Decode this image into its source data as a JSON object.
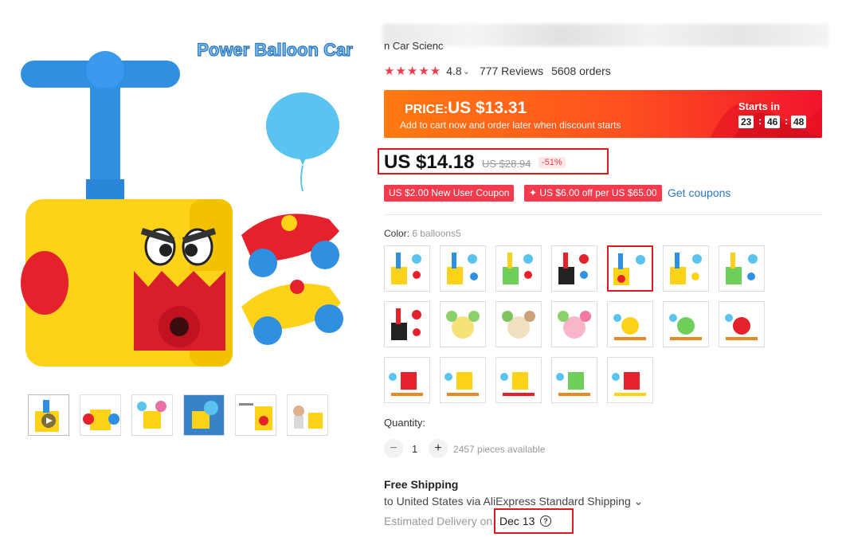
{
  "gallery": {
    "banner_text": "Power Balloon Car",
    "thumbnail_count": 6
  },
  "product": {
    "title_partial": "n Car Scienc",
    "rating": "4.8",
    "rating_suffix": "⌄",
    "reviews": "777 Reviews",
    "orders": "5608 orders"
  },
  "promo": {
    "price_label": "PRICE:",
    "price": "US $13.31",
    "subtitle": "Add to cart now and order later when discount starts",
    "starts_label": "Starts in",
    "hours": "23",
    "minutes": "46",
    "seconds": "48",
    "separator": ":"
  },
  "price": {
    "current": "US $14.18",
    "original": "US $28.94",
    "discount": "-51%"
  },
  "coupons": {
    "new_user": "US $2.00 New User Coupon",
    "store": "✦ US $6.00 off per US $65.00",
    "get_link": "Get coupons"
  },
  "color": {
    "label": "Color:",
    "value": "6 balloons5",
    "selected_index": 4,
    "option_count": 19
  },
  "quantity": {
    "label": "Quantity:",
    "minus": "−",
    "value": "1",
    "plus": "+",
    "available": "2457 pieces available"
  },
  "shipping": {
    "title": "Free Shipping",
    "line": "to United States via AliExpress Standard Shipping ⌄",
    "estimated_label": "Estimated Delivery on",
    "date": "Dec 13",
    "help": "?"
  },
  "colors": {
    "accent_red": "#e0191c",
    "star_red": "#f23a4a",
    "link_blue": "#2a78c5",
    "toy_yellow": "#ffd21a",
    "toy_blue": "#2f8fe0"
  }
}
